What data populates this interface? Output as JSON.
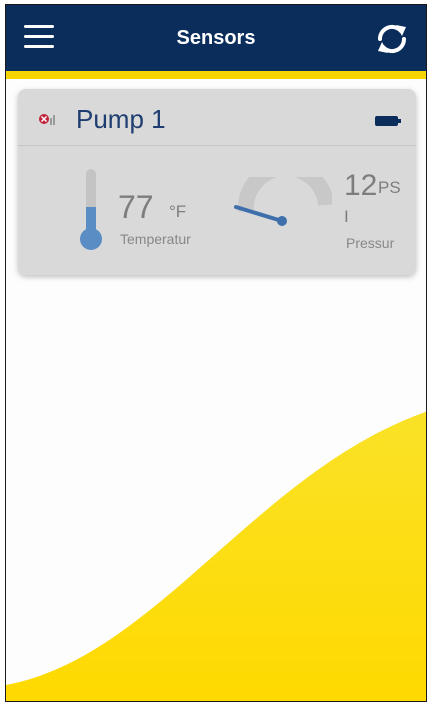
{
  "header": {
    "title": "Sensors",
    "menu_icon": "hamburger-menu-icon",
    "refresh_icon": "refresh-icon",
    "bg_color": "#0b2d5c",
    "accent_color": "#f6d400"
  },
  "card": {
    "name": "Pump 1",
    "signal_icon": "signal-disconnected-icon",
    "battery_icon": "battery-full-icon",
    "temperature": {
      "value": "77",
      "unit": "°F",
      "label": "Temperatur"
    },
    "pressure": {
      "value": "12",
      "unit": "PS",
      "unit_cont": "I",
      "label": "Pressur"
    }
  }
}
